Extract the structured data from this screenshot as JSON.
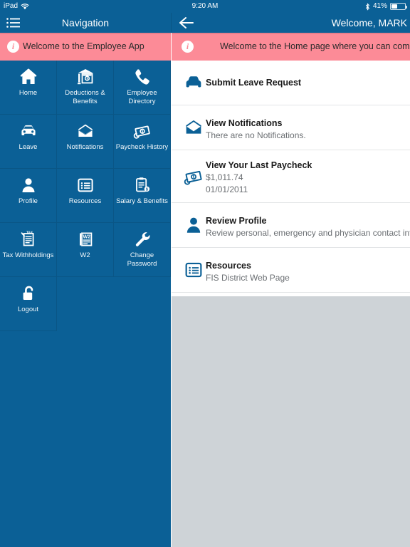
{
  "status_bar": {
    "device": "iPad",
    "wifi_icon": "wifi-icon",
    "time": "9:20 AM",
    "bluetooth_icon": "bluetooth-icon",
    "battery_percent": "41%",
    "battery_icon": "battery-icon"
  },
  "nav_left": {
    "menu_icon": "list-menu-icon",
    "title": "Navigation"
  },
  "nav_right": {
    "back_icon": "back-arrow-icon",
    "title": "Welcome, MARK"
  },
  "banner_left": {
    "icon": "info-icon",
    "text": "Welcome to the Employee App"
  },
  "banner_right": {
    "icon": "info-icon",
    "text": "Welcome to the Home page where you can comp"
  },
  "nav_tiles": [
    {
      "label": "Home",
      "icon": "home-icon"
    },
    {
      "label": "Deductions & Benefits",
      "icon": "bank-icon"
    },
    {
      "label": "Employee Directory",
      "icon": "phone-icon"
    },
    {
      "label": "Leave",
      "icon": "car-icon"
    },
    {
      "label": "Notifications",
      "icon": "envelope-icon"
    },
    {
      "label": "Paycheck History",
      "icon": "money-icon"
    },
    {
      "label": "Profile",
      "icon": "person-icon"
    },
    {
      "label": "Resources",
      "icon": "list-card-icon"
    },
    {
      "label": "Salary & Benefits",
      "icon": "clipboard-dollar-icon"
    },
    {
      "label": "Tax Withholdings",
      "icon": "tax-form-icon"
    },
    {
      "label": "W2",
      "icon": "w2-document-icon"
    },
    {
      "label": "Change Password",
      "icon": "wrench-icon"
    },
    {
      "label": "Logout",
      "icon": "open-padlock-icon"
    }
  ],
  "home_list": [
    {
      "title": "Submit Leave Request",
      "sub1": "",
      "sub2": "",
      "icon": "car-icon"
    },
    {
      "title": "View Notifications",
      "sub1": "There are no Notifications.",
      "sub2": "",
      "icon": "envelope-icon"
    },
    {
      "title": "View Your Last Paycheck",
      "sub1": "$1,011.74",
      "sub2": "01/01/2011",
      "icon": "money-icon"
    },
    {
      "title": "Review Profile",
      "sub1": "Review personal, emergency and physician contact informatio",
      "sub2": "",
      "icon": "person-icon"
    },
    {
      "title": "Resources",
      "sub1": "FIS District Web Page",
      "sub2": "",
      "icon": "list-card-icon"
    }
  ],
  "colors": {
    "brand_blue": "#0b6096",
    "banner_pink": "#fc8b97",
    "list_background": "#ffffff",
    "empty_area_gray": "#ced3d7"
  }
}
